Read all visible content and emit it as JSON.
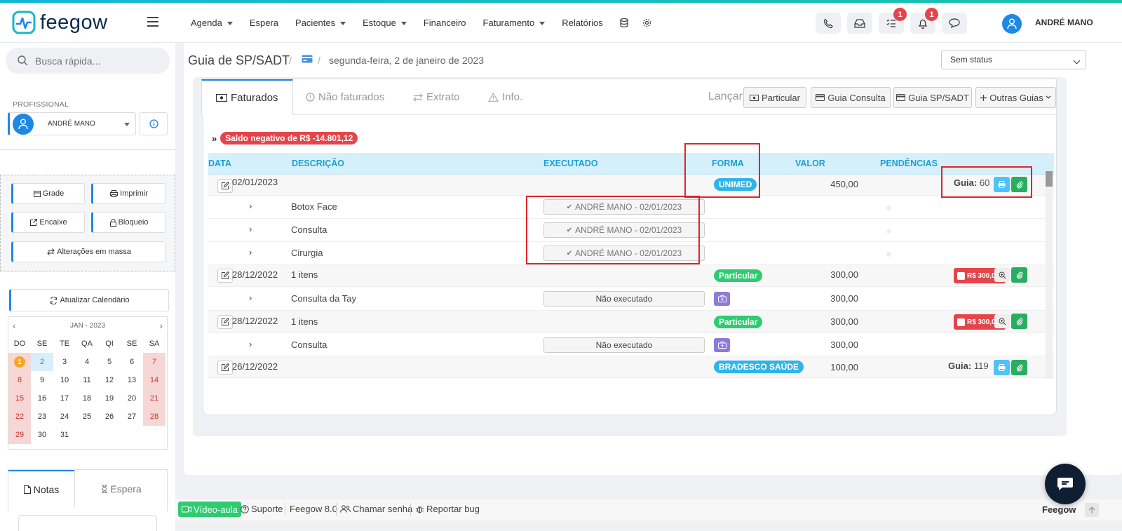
{
  "app": {
    "name": "feegow"
  },
  "nav": {
    "items": [
      {
        "label": "Agenda",
        "dropdown": true
      },
      {
        "label": "Espera",
        "dropdown": false
      },
      {
        "label": "Pacientes",
        "dropdown": true
      },
      {
        "label": "Estoque",
        "dropdown": true
      },
      {
        "label": "Financeiro",
        "dropdown": false
      },
      {
        "label": "Faturamento",
        "dropdown": true
      },
      {
        "label": "Relatórios",
        "dropdown": false
      }
    ],
    "icons": [
      "database-icon",
      "gear-icon"
    ]
  },
  "topbar": {
    "buttons": [
      {
        "icon": "phone-icon",
        "badge": ""
      },
      {
        "icon": "inbox-icon",
        "badge": ""
      },
      {
        "icon": "checklist-icon",
        "badge": "1"
      },
      {
        "icon": "bell-icon",
        "badge": "1"
      },
      {
        "icon": "chat-icon",
        "badge": ""
      }
    ],
    "user_name": "ANDRÉ MANO"
  },
  "sidebar": {
    "search_placeholder": "Busca rápida...",
    "profissional_label": "PROFISSIONAL",
    "profissional_name": "ANDRÉ MANO",
    "actions": {
      "grade": "Grade",
      "imprimir": "Imprimir",
      "encaixe": "Encaixe",
      "bloqueio": "Bloqueio",
      "alteracoes": "Alterações em massa"
    },
    "refresh_label": "Atualizar Calendário",
    "calendar": {
      "month": "JAN - 2023",
      "days_header": [
        "DO",
        "SE",
        "TE",
        "QA",
        "QI",
        "SE",
        "SA"
      ],
      "weeks": [
        [
          "1",
          "2",
          "3",
          "4",
          "5",
          "6",
          "7"
        ],
        [
          "8",
          "9",
          "10",
          "11",
          "12",
          "13",
          "14"
        ],
        [
          "15",
          "16",
          "17",
          "18",
          "19",
          "20",
          "21"
        ],
        [
          "22",
          "23",
          "24",
          "25",
          "26",
          "27",
          "28"
        ],
        [
          "29",
          "30",
          "31",
          "",
          "",
          "",
          ""
        ]
      ],
      "today": "1",
      "selected": "2"
    },
    "tabs": {
      "notas": "Notas",
      "espera": "Espera"
    }
  },
  "page": {
    "title": "Guia de SP/SADT",
    "breadcrumb_date": "segunda-feira, 2 de janeiro de 2023",
    "status_select": "Sem status"
  },
  "panel": {
    "tabs": {
      "faturados": "Faturados",
      "nao_faturados": "Não faturados",
      "extrato": "Extrato",
      "info": "Info."
    },
    "lancar_label": "Lançar",
    "lancar_buttons": {
      "particular": "Particular",
      "guia_consulta": "Guia Consulta",
      "guia_sadt": "Guia SP/SADT",
      "outras": "Outras Guias"
    },
    "saldo_arrow": "»",
    "saldo": "Saldo negativo de R$ -14.801,12",
    "columns": {
      "data": "DATA",
      "descricao": "DESCRIÇÃO",
      "executado": "EXECUTADO",
      "forma": "FORMA",
      "valor": "VALOR",
      "pendencias": "PENDÊNCIAS"
    },
    "rows": {
      "r1": {
        "date": "02/01/2023",
        "forma": "UNIMED",
        "valor": "450,00",
        "guia_label": "Guia:",
        "guia_num": "60"
      },
      "r1_items": [
        {
          "desc": "Botox Face",
          "exec": "ANDRÉ MANO - 02/01/2023"
        },
        {
          "desc": "Consulta",
          "exec": "ANDRÉ MANO - 02/01/2023"
        },
        {
          "desc": "Cirurgia",
          "exec": "ANDRÉ MANO - 02/01/2023"
        }
      ],
      "r2": {
        "date": "28/12/2022",
        "desc": "1 itens",
        "forma": "Particular",
        "valor": "300,00",
        "pay": "R$ 300,00"
      },
      "r2_item": {
        "desc": "Consulta da Tay",
        "exec": "Não executado",
        "valor": "300,00"
      },
      "r3": {
        "date": "28/12/2022",
        "desc": "1 itens",
        "forma": "Particular",
        "valor": "300,00",
        "pay": "R$ 300,00"
      },
      "r3_item": {
        "desc": "Consulta",
        "exec": "Não executado",
        "valor": "300,00"
      },
      "r4": {
        "date": "26/12/2022",
        "forma": "BRADESCO SAÚDE",
        "valor": "100,00",
        "guia_label": "Guia:",
        "guia_num": "119"
      }
    }
  },
  "footer": {
    "video": "Vídeo-aula",
    "suporte": "Suporte",
    "version": "Feegow 8.0",
    "chamar": "Chamar senha",
    "bug": "Reportar bug",
    "brand": "Feegow"
  },
  "colors": {
    "accent": "#1e88e5",
    "danger": "#e5454a",
    "success": "#2ecc71",
    "info": "#2eb4ea",
    "highlight": "#e0242b"
  }
}
